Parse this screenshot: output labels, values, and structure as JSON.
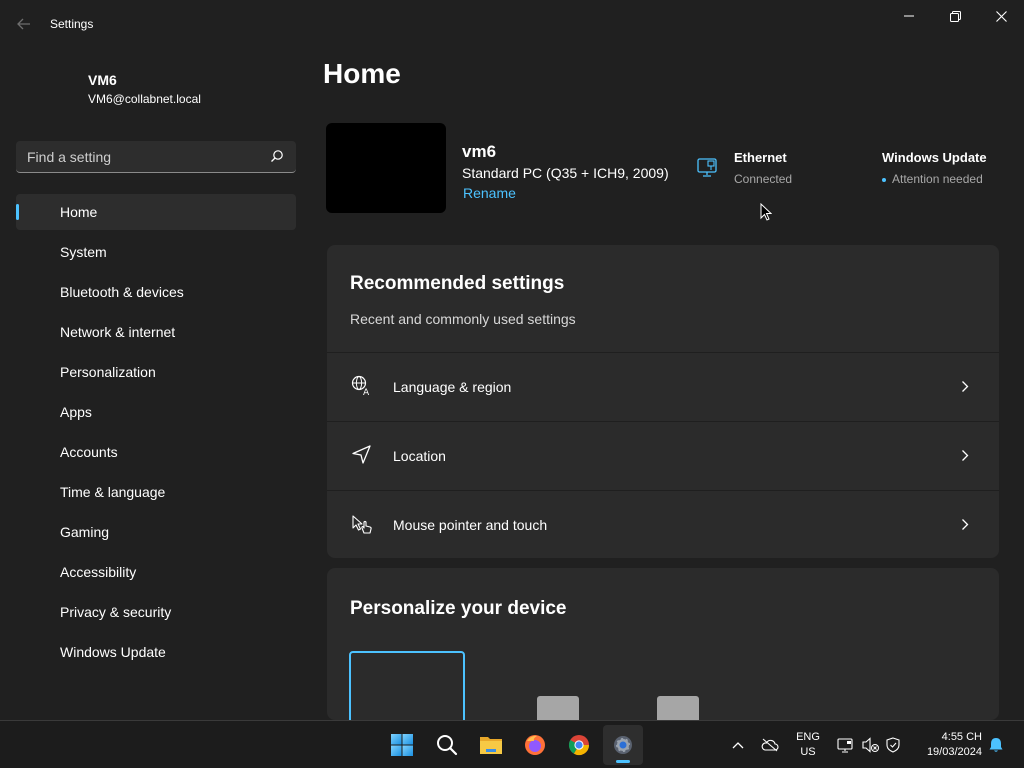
{
  "window": {
    "title": "Settings",
    "controls": [
      "minimize-icon",
      "restore-icon",
      "close-icon"
    ]
  },
  "account": {
    "name": "VM6",
    "email": "VM6@collabnet.local"
  },
  "search": {
    "placeholder": "Find a setting",
    "icon": "search-icon"
  },
  "nav": {
    "items": [
      {
        "label": "Home",
        "active": true
      },
      {
        "label": "System"
      },
      {
        "label": "Bluetooth & devices"
      },
      {
        "label": "Network & internet"
      },
      {
        "label": "Personalization"
      },
      {
        "label": "Apps"
      },
      {
        "label": "Accounts"
      },
      {
        "label": "Time & language"
      },
      {
        "label": "Gaming"
      },
      {
        "label": "Accessibility"
      },
      {
        "label": "Privacy & security"
      },
      {
        "label": "Windows Update"
      }
    ]
  },
  "main": {
    "title": "Home",
    "device": {
      "name": "vm6",
      "model": "Standard PC (Q35 + ICH9, 2009)",
      "rename_label": "Rename"
    },
    "ethernet": {
      "title": "Ethernet",
      "status": "Connected",
      "icon": "ethernet-monitor-icon"
    },
    "windows_update": {
      "title": "Windows Update",
      "status": "Attention needed"
    },
    "recommended": {
      "title": "Recommended settings",
      "subtitle": "Recent and commonly used settings",
      "items": [
        {
          "label": "Language & region",
          "icon": "language-icon"
        },
        {
          "label": "Location",
          "icon": "location-arrow-icon"
        },
        {
          "label": "Mouse pointer and touch",
          "icon": "mouse-pointer-touch-icon"
        }
      ]
    },
    "personalize": {
      "title": "Personalize your device"
    }
  },
  "taskbar": {
    "apps": [
      "windows-start-icon",
      "search-icon",
      "file-explorer-icon",
      "firefox-icon",
      "chrome-icon",
      "settings-gear-icon"
    ],
    "active_app": "settings-gear-icon",
    "language": {
      "line1": "ENG",
      "line2": "US"
    },
    "clock": {
      "time": "4:55 CH",
      "date": "19/03/2024"
    }
  },
  "colors": {
    "background": "#202020",
    "card": "#2b2b2b",
    "accent": "#4cc2ff",
    "taskbar": "#1c1c1c"
  }
}
